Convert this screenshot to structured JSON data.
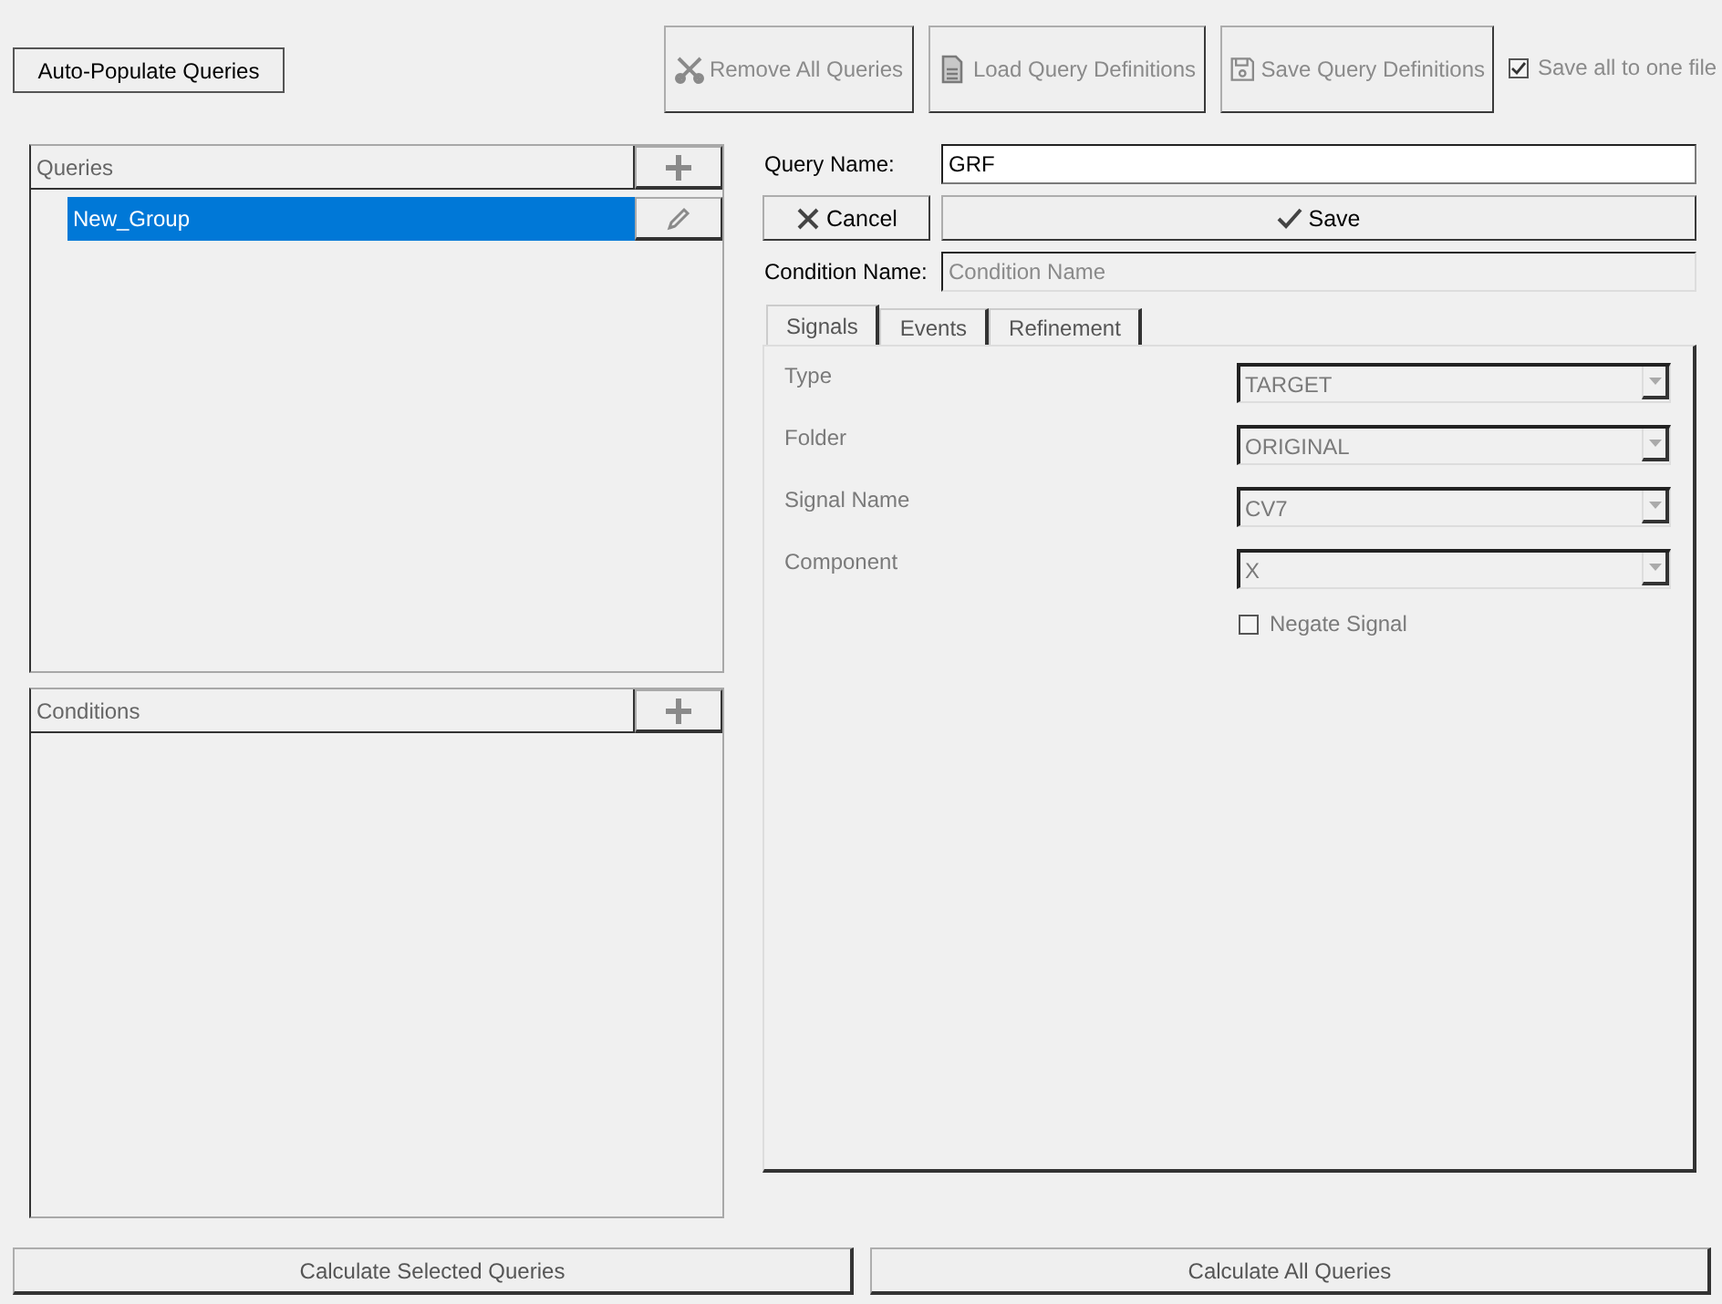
{
  "toolbar": {
    "auto_populate": {
      "label": "Auto-Populate Queries",
      "disabled": false
    },
    "buttons": [
      {
        "label": "Remove All Queries",
        "kind": "remove",
        "disabled": true
      },
      {
        "label": "Load Query Definitions",
        "kind": "load",
        "disabled": true
      },
      {
        "label": "Save Query Definitions",
        "kind": "save",
        "disabled": true
      }
    ],
    "save_all": {
      "label": "Save all to one file",
      "checked": true,
      "disabled": true
    }
  },
  "queries": {
    "header": "Queries",
    "items": [
      {
        "label": "New_Group",
        "selected": true
      }
    ]
  },
  "conditions": {
    "header": "Conditions"
  },
  "editor": {
    "query_name_label": "Query Name:",
    "query_name": "GRF",
    "cancel": "Cancel",
    "save": "Save",
    "condition_name_label": "Condition Name:",
    "condition_name_placeholder": "Condition Name"
  },
  "tabs": [
    {
      "label": "Signals",
      "selected": true
    },
    {
      "label": "Events",
      "selected": false
    },
    {
      "label": "Refinement",
      "selected": false
    }
  ],
  "signals": {
    "fields": [
      {
        "label": "Type",
        "value": "TARGET",
        "disabled": true
      },
      {
        "label": "Folder",
        "value": "ORIGINAL",
        "disabled": true
      },
      {
        "label": "Signal Name",
        "value": "CV7",
        "disabled": true
      },
      {
        "label": "Component",
        "value": "X",
        "disabled": true
      }
    ],
    "negate": {
      "label": "Negate Signal",
      "checked": false,
      "disabled": true
    }
  },
  "bottom_buttons": [
    "Calculate Selected Queries",
    "Calculate All Queries"
  ]
}
